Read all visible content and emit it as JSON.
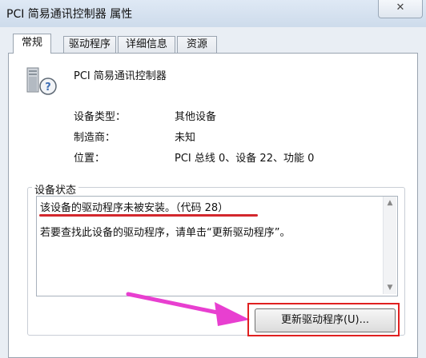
{
  "window": {
    "title": "PCI 简易通讯控制器 属性",
    "close_glyph": "✕"
  },
  "tabs": [
    {
      "label": "常规",
      "active": true
    },
    {
      "label": "驱动程序",
      "active": false
    },
    {
      "label": "详细信息",
      "active": false
    },
    {
      "label": "资源",
      "active": false
    }
  ],
  "device": {
    "name": "PCI 简易通讯控制器",
    "icon": "unknown-device-icon"
  },
  "properties": [
    {
      "label": "设备类型：",
      "value": "其他设备"
    },
    {
      "label": "制造商：",
      "value": "未知"
    },
    {
      "label": "位置：",
      "value": "PCI 总线 0、设备 22、功能 0"
    }
  ],
  "status": {
    "group_title": "设备状态",
    "line1": "该设备的驱动程序未被安装。（代码 28）",
    "line2": "若要查找此设备的驱动程序，请单击“更新驱动程序”。"
  },
  "buttons": {
    "update_driver": "更新驱动程序(U)..."
  },
  "colors": {
    "annotation_red": "#d3272d",
    "arrow_magenta": "#e83fd0"
  }
}
